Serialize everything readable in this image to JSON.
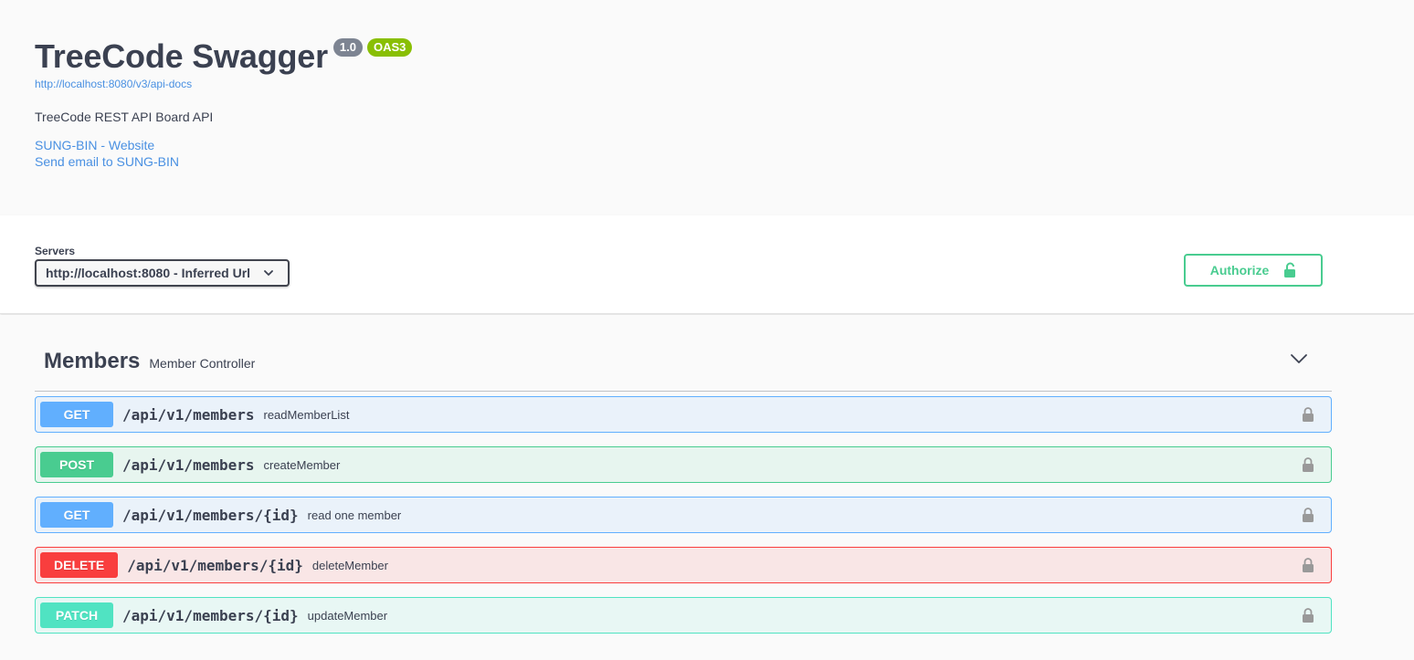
{
  "info": {
    "title": "TreeCode Swagger",
    "version": "1.0",
    "oas_badge": "OAS3",
    "api_url": "http://localhost:8080/v3/api-docs",
    "description": "TreeCode REST API Board API",
    "contact_website": "SUNG-BIN - Website",
    "contact_email": "Send email to SUNG-BIN"
  },
  "scheme": {
    "servers_label": "Servers",
    "selected_server": "http://localhost:8080 - Inferred Url",
    "authorize_label": "Authorize"
  },
  "tag": {
    "name": "Members",
    "description": "Member Controller"
  },
  "operations": [
    {
      "method": "GET",
      "path": "/api/v1/members",
      "summary": "readMemberList"
    },
    {
      "method": "POST",
      "path": "/api/v1/members",
      "summary": "createMember"
    },
    {
      "method": "GET",
      "path": "/api/v1/members/{id}",
      "summary": "read one member"
    },
    {
      "method": "DELETE",
      "path": "/api/v1/members/{id}",
      "summary": "deleteMember"
    },
    {
      "method": "PATCH",
      "path": "/api/v1/members/{id}",
      "summary": "updateMember"
    }
  ],
  "colors": {
    "get": "#61affe",
    "post": "#49cc90",
    "delete": "#f93e3e",
    "patch": "#50e3c2",
    "link": "#4990e2",
    "version_badge": "#7d8492",
    "oas_badge": "#89bf04"
  },
  "icons": {
    "server_dropdown": "chevron-down-icon",
    "authorize": "lock-open-icon",
    "tag_toggle": "chevron-down-icon",
    "operation_auth": "lock-icon"
  }
}
